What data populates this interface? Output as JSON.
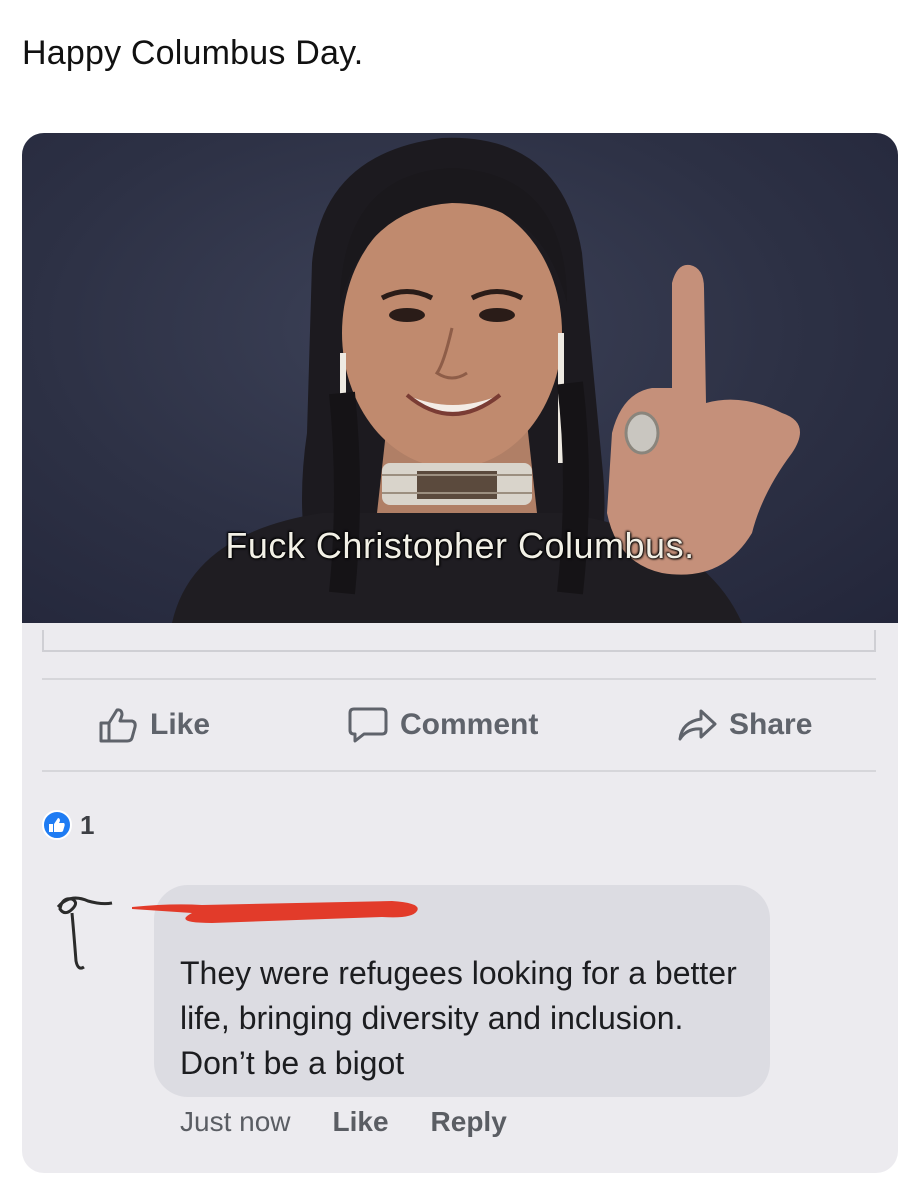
{
  "post": {
    "caption": "Happy Columbus Day.",
    "image": {
      "subtitle": "Fuck Christopher Columbus.",
      "description_icon": "portrait-photo"
    },
    "actions": {
      "like_label": "Like",
      "comment_label": "Comment",
      "share_label": "Share",
      "like_icon": "thumbs-up-outline-icon",
      "comment_icon": "speech-bubble-icon",
      "share_icon": "share-arrow-icon"
    },
    "reactions": {
      "count": "1",
      "icon": "like-badge-icon",
      "badge_color": "#1f7cf3"
    }
  },
  "comment": {
    "author_redacted": true,
    "redaction_color": "#e23b2a",
    "text": "They were refugees looking for a better life, bringing diversity and inclusion. Don’t be a bigot",
    "timestamp": "Just now",
    "like_label": "Like",
    "reply_label": "Reply"
  },
  "colors": {
    "card_background": "#ecebef",
    "bubble_background": "#dcdce2",
    "action_text": "#5f636b"
  }
}
